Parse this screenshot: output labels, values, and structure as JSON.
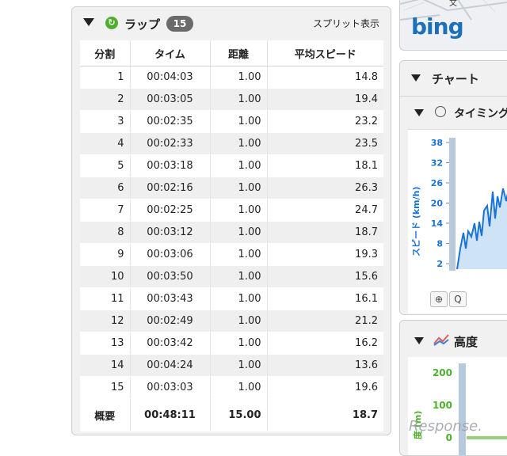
{
  "laps": {
    "title": "ラップ",
    "count": "15",
    "split_link": "スプリット表示",
    "columns": [
      "分割",
      "タイム",
      "距離",
      "平均スピード"
    ],
    "rows": [
      [
        "1",
        "00:04:03",
        "1.00",
        "14.8"
      ],
      [
        "2",
        "00:03:05",
        "1.00",
        "19.4"
      ],
      [
        "3",
        "00:02:35",
        "1.00",
        "23.2"
      ],
      [
        "4",
        "00:02:33",
        "1.00",
        "23.5"
      ],
      [
        "5",
        "00:03:18",
        "1.00",
        "18.1"
      ],
      [
        "6",
        "00:02:16",
        "1.00",
        "26.3"
      ],
      [
        "7",
        "00:02:25",
        "1.00",
        "24.7"
      ],
      [
        "8",
        "00:03:12",
        "1.00",
        "18.7"
      ],
      [
        "9",
        "00:03:06",
        "1.00",
        "19.3"
      ],
      [
        "10",
        "00:03:50",
        "1.00",
        "15.6"
      ],
      [
        "11",
        "00:03:43",
        "1.00",
        "16.1"
      ],
      [
        "12",
        "00:02:49",
        "1.00",
        "21.2"
      ],
      [
        "13",
        "00:03:42",
        "1.00",
        "16.2"
      ],
      [
        "14",
        "00:04:24",
        "1.00",
        "13.6"
      ],
      [
        "15",
        "00:03:03",
        "1.00",
        "19.6"
      ]
    ],
    "summary": [
      "概要",
      "00:48:11",
      "15.00",
      "18.7"
    ]
  },
  "map": {
    "provider": "bing",
    "marker": "文"
  },
  "chart_panel": {
    "title": "チャート"
  },
  "timing": {
    "title": "タイミング",
    "ylabel": "スピード (km/h)",
    "ticks": [
      "38",
      "32",
      "26",
      "20",
      "14",
      "8",
      "2"
    ],
    "zoom_in": "⊕",
    "zoom_out": "Q"
  },
  "altitude": {
    "title": "高度",
    "ylabel": "度 (m)",
    "ticks": [
      "200",
      "100",
      "0"
    ]
  },
  "watermark": "Response.",
  "colors": {
    "speed_line": "#1a73d9",
    "speed_fill": "#cfe3f7",
    "axis_speed": "#1a73d9",
    "axis_alt": "#4caf2d",
    "badge": "#6b6b6b"
  }
}
